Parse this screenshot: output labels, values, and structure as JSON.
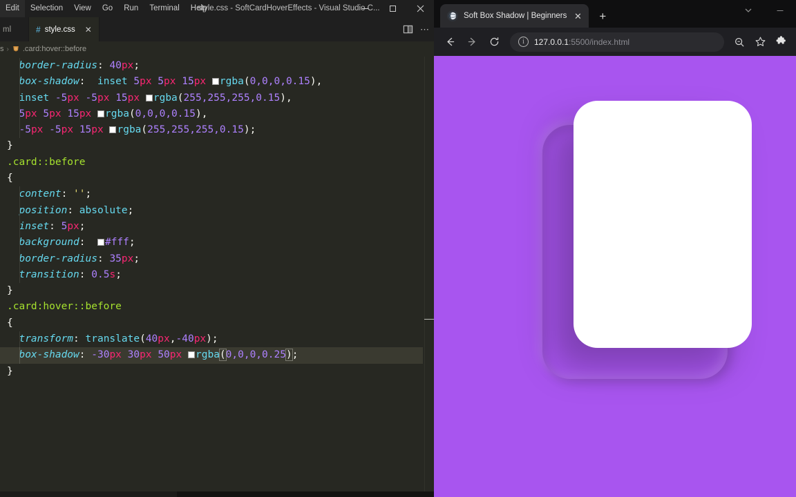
{
  "editor": {
    "app_title": "style.css - SoftCardHoverEffects - Visual Studio C...",
    "menu": [
      "Edit",
      "Selection",
      "View",
      "Go",
      "Run",
      "Terminal",
      "Help"
    ],
    "window_controls": {
      "minimize": "—",
      "maximize": "☐",
      "close": "✕"
    },
    "tabs": [
      {
        "label": "ml",
        "icon": "",
        "active": false
      },
      {
        "label": "style.css",
        "icon": "#",
        "active": true,
        "close": "✕"
      }
    ],
    "tab_actions": {
      "split_editor": "split-editor-icon",
      "more_actions": "⋯"
    },
    "breadcrumb": {
      "file": "s",
      "separator": "›",
      "symbol_icon": "css-symbol-icon",
      "symbol": ".card:hover::before"
    },
    "code_lines": [
      {
        "indent": true,
        "tokens": [
          {
            "t": "  ",
            "c": "t-plain"
          },
          {
            "t": "border-radius",
            "c": "t-prop"
          },
          {
            "t": ":",
            "c": "t-punc"
          },
          {
            "t": " ",
            "c": "t-plain"
          },
          {
            "t": "40",
            "c": "t-num"
          },
          {
            "t": "px",
            "c": "t-unit"
          },
          {
            "t": ";",
            "c": "t-punc"
          }
        ]
      },
      {
        "indent": true,
        "tokens": [
          {
            "t": "  ",
            "c": "t-plain"
          },
          {
            "t": "box-shadow",
            "c": "t-prop"
          },
          {
            "t": ":",
            "c": "t-punc"
          },
          {
            "t": "  inset ",
            "c": "t-val"
          },
          {
            "t": "5",
            "c": "t-num"
          },
          {
            "t": "px",
            "c": "t-unit"
          },
          {
            "t": " ",
            "c": "t-plain"
          },
          {
            "t": "5",
            "c": "t-num"
          },
          {
            "t": "px",
            "c": "t-unit"
          },
          {
            "t": " ",
            "c": "t-plain"
          },
          {
            "t": "15",
            "c": "t-num"
          },
          {
            "t": "px",
            "c": "t-unit"
          },
          {
            "t": " ",
            "c": "t-plain"
          },
          {
            "t": "SWATCH",
            "c": "swatch"
          },
          {
            "t": "rgba",
            "c": "t-fn"
          },
          {
            "t": "(",
            "c": "t-paren"
          },
          {
            "t": "0,0,0,0.15",
            "c": "t-num"
          },
          {
            "t": ")",
            "c": "t-paren"
          },
          {
            "t": ",",
            "c": "t-punc"
          }
        ]
      },
      {
        "indent": true,
        "tokens": [
          {
            "t": "  inset ",
            "c": "t-val"
          },
          {
            "t": "-5",
            "c": "t-num"
          },
          {
            "t": "px",
            "c": "t-unit"
          },
          {
            "t": " ",
            "c": "t-plain"
          },
          {
            "t": "-5",
            "c": "t-num"
          },
          {
            "t": "px",
            "c": "t-unit"
          },
          {
            "t": " ",
            "c": "t-plain"
          },
          {
            "t": "15",
            "c": "t-num"
          },
          {
            "t": "px",
            "c": "t-unit"
          },
          {
            "t": " ",
            "c": "t-plain"
          },
          {
            "t": "SWATCH",
            "c": "swatch"
          },
          {
            "t": "rgba",
            "c": "t-fn"
          },
          {
            "t": "(",
            "c": "t-paren"
          },
          {
            "t": "255,255,255,0.15",
            "c": "t-num"
          },
          {
            "t": ")",
            "c": "t-paren"
          },
          {
            "t": ",",
            "c": "t-punc"
          }
        ]
      },
      {
        "indent": true,
        "tokens": [
          {
            "t": "  ",
            "c": "t-plain"
          },
          {
            "t": "5",
            "c": "t-num"
          },
          {
            "t": "px",
            "c": "t-unit"
          },
          {
            "t": " ",
            "c": "t-plain"
          },
          {
            "t": "5",
            "c": "t-num"
          },
          {
            "t": "px",
            "c": "t-unit"
          },
          {
            "t": " ",
            "c": "t-plain"
          },
          {
            "t": "15",
            "c": "t-num"
          },
          {
            "t": "px",
            "c": "t-unit"
          },
          {
            "t": " ",
            "c": "t-plain"
          },
          {
            "t": "SWATCH",
            "c": "swatch"
          },
          {
            "t": "rgba",
            "c": "t-fn"
          },
          {
            "t": "(",
            "c": "t-paren"
          },
          {
            "t": "0,0,0,0.15",
            "c": "t-num"
          },
          {
            "t": ")",
            "c": "t-paren"
          },
          {
            "t": ",",
            "c": "t-punc"
          }
        ]
      },
      {
        "indent": true,
        "tokens": [
          {
            "t": "  ",
            "c": "t-plain"
          },
          {
            "t": "-5",
            "c": "t-num"
          },
          {
            "t": "px",
            "c": "t-unit"
          },
          {
            "t": " ",
            "c": "t-plain"
          },
          {
            "t": "-5",
            "c": "t-num"
          },
          {
            "t": "px",
            "c": "t-unit"
          },
          {
            "t": " ",
            "c": "t-plain"
          },
          {
            "t": "15",
            "c": "t-num"
          },
          {
            "t": "px",
            "c": "t-unit"
          },
          {
            "t": " ",
            "c": "t-plain"
          },
          {
            "t": "SWATCH",
            "c": "swatch"
          },
          {
            "t": "rgba",
            "c": "t-fn"
          },
          {
            "t": "(",
            "c": "t-paren"
          },
          {
            "t": "255,255,255,0.15",
            "c": "t-num"
          },
          {
            "t": ")",
            "c": "t-paren"
          },
          {
            "t": ";",
            "c": "t-punc"
          }
        ]
      },
      {
        "indent": false,
        "tokens": [
          {
            "t": "}",
            "c": "t-punc"
          }
        ]
      },
      {
        "indent": false,
        "tokens": [
          {
            "t": ".card::before",
            "c": "t-sel"
          }
        ]
      },
      {
        "indent": false,
        "tokens": [
          {
            "t": "{",
            "c": "t-punc"
          }
        ]
      },
      {
        "indent": true,
        "tokens": [
          {
            "t": "  ",
            "c": "t-plain"
          },
          {
            "t": "content",
            "c": "t-prop"
          },
          {
            "t": ":",
            "c": "t-punc"
          },
          {
            "t": " ",
            "c": "t-plain"
          },
          {
            "t": "''",
            "c": "t-str"
          },
          {
            "t": ";",
            "c": "t-punc"
          }
        ]
      },
      {
        "indent": true,
        "tokens": [
          {
            "t": "  ",
            "c": "t-plain"
          },
          {
            "t": "position",
            "c": "t-prop"
          },
          {
            "t": ":",
            "c": "t-punc"
          },
          {
            "t": " absolute",
            "c": "t-val"
          },
          {
            "t": ";",
            "c": "t-punc"
          }
        ]
      },
      {
        "indent": true,
        "tokens": [
          {
            "t": "  ",
            "c": "t-plain"
          },
          {
            "t": "inset",
            "c": "t-prop"
          },
          {
            "t": ":",
            "c": "t-punc"
          },
          {
            "t": " ",
            "c": "t-plain"
          },
          {
            "t": "5",
            "c": "t-num"
          },
          {
            "t": "px",
            "c": "t-unit"
          },
          {
            "t": ";",
            "c": "t-punc"
          }
        ]
      },
      {
        "indent": true,
        "tokens": [
          {
            "t": "  ",
            "c": "t-plain"
          },
          {
            "t": "background",
            "c": "t-prop"
          },
          {
            "t": ":",
            "c": "t-punc"
          },
          {
            "t": "  ",
            "c": "t-plain"
          },
          {
            "t": "SWATCH",
            "c": "swatch"
          },
          {
            "t": "#fff",
            "c": "t-num"
          },
          {
            "t": ";",
            "c": "t-punc"
          }
        ]
      },
      {
        "indent": true,
        "tokens": [
          {
            "t": "  ",
            "c": "t-plain"
          },
          {
            "t": "border-radius",
            "c": "t-prop"
          },
          {
            "t": ":",
            "c": "t-punc"
          },
          {
            "t": " ",
            "c": "t-plain"
          },
          {
            "t": "35",
            "c": "t-num"
          },
          {
            "t": "px",
            "c": "t-unit"
          },
          {
            "t": ";",
            "c": "t-punc"
          }
        ]
      },
      {
        "indent": true,
        "tokens": [
          {
            "t": "  ",
            "c": "t-plain"
          },
          {
            "t": "transition",
            "c": "t-prop"
          },
          {
            "t": ":",
            "c": "t-punc"
          },
          {
            "t": " ",
            "c": "t-plain"
          },
          {
            "t": "0.5",
            "c": "t-num"
          },
          {
            "t": "s",
            "c": "t-unit"
          },
          {
            "t": ";",
            "c": "t-punc"
          }
        ]
      },
      {
        "indent": false,
        "tokens": [
          {
            "t": "}",
            "c": "t-punc"
          }
        ]
      },
      {
        "indent": false,
        "tokens": [
          {
            "t": ".card:hover::before",
            "c": "t-sel"
          }
        ]
      },
      {
        "indent": false,
        "tokens": [
          {
            "t": "{",
            "c": "t-punc"
          }
        ]
      },
      {
        "indent": true,
        "tokens": [
          {
            "t": "  ",
            "c": "t-plain"
          },
          {
            "t": "transform",
            "c": "t-prop"
          },
          {
            "t": ":",
            "c": "t-punc"
          },
          {
            "t": " ",
            "c": "t-plain"
          },
          {
            "t": "translate",
            "c": "t-fn"
          },
          {
            "t": "(",
            "c": "t-paren"
          },
          {
            "t": "40",
            "c": "t-num"
          },
          {
            "t": "px",
            "c": "t-unit"
          },
          {
            "t": ",",
            "c": "t-punc"
          },
          {
            "t": "-40",
            "c": "t-num"
          },
          {
            "t": "px",
            "c": "t-unit"
          },
          {
            "t": ")",
            "c": "t-paren"
          },
          {
            "t": ";",
            "c": "t-punc"
          }
        ]
      },
      {
        "indent": true,
        "highlight": true,
        "tokens": [
          {
            "t": "  ",
            "c": "t-plain"
          },
          {
            "t": "box-shadow",
            "c": "t-prop"
          },
          {
            "t": ":",
            "c": "t-punc"
          },
          {
            "t": " ",
            "c": "t-plain"
          },
          {
            "t": "-30",
            "c": "t-num"
          },
          {
            "t": "px",
            "c": "t-unit"
          },
          {
            "t": " ",
            "c": "t-plain"
          },
          {
            "t": "30",
            "c": "t-num"
          },
          {
            "t": "px",
            "c": "t-unit"
          },
          {
            "t": " ",
            "c": "t-plain"
          },
          {
            "t": "50",
            "c": "t-num"
          },
          {
            "t": "px",
            "c": "t-unit"
          },
          {
            "t": " ",
            "c": "t-plain"
          },
          {
            "t": "SWATCH",
            "c": "swatch"
          },
          {
            "t": "rgba",
            "c": "t-fn"
          },
          {
            "t": "(",
            "c": "t-paren brkt"
          },
          {
            "t": "0,0,0,0.25",
            "c": "t-num"
          },
          {
            "t": ")",
            "c": "t-paren brkt"
          },
          {
            "t": ";",
            "c": "t-punc"
          }
        ]
      },
      {
        "indent": false,
        "tokens": [
          {
            "t": "}",
            "c": "t-punc"
          }
        ]
      }
    ]
  },
  "browser": {
    "tab": {
      "title": "Soft Box Shadow | Beginners",
      "favicon": "globe-icon",
      "close": "✕"
    },
    "new_tab": "+",
    "window_controls": {
      "tab_search": "⌄",
      "minimize": "—"
    },
    "nav": {
      "back": "←",
      "forward": "→",
      "reload": "⟳"
    },
    "omnibox": {
      "info_icon": "ⓘ",
      "url_host": "127.0.0.1",
      "url_path": ":5500/index.html"
    },
    "toolbar_icons": {
      "zoom": "search-zoom-icon",
      "bookmark": "☆",
      "extensions": "puzzle-icon"
    },
    "page": {
      "background_color": "#a855ef",
      "card_color": "#a855ef",
      "card_before_color": "#ffffff",
      "card_radius": "40px",
      "card_before_radius": "35px"
    }
  }
}
